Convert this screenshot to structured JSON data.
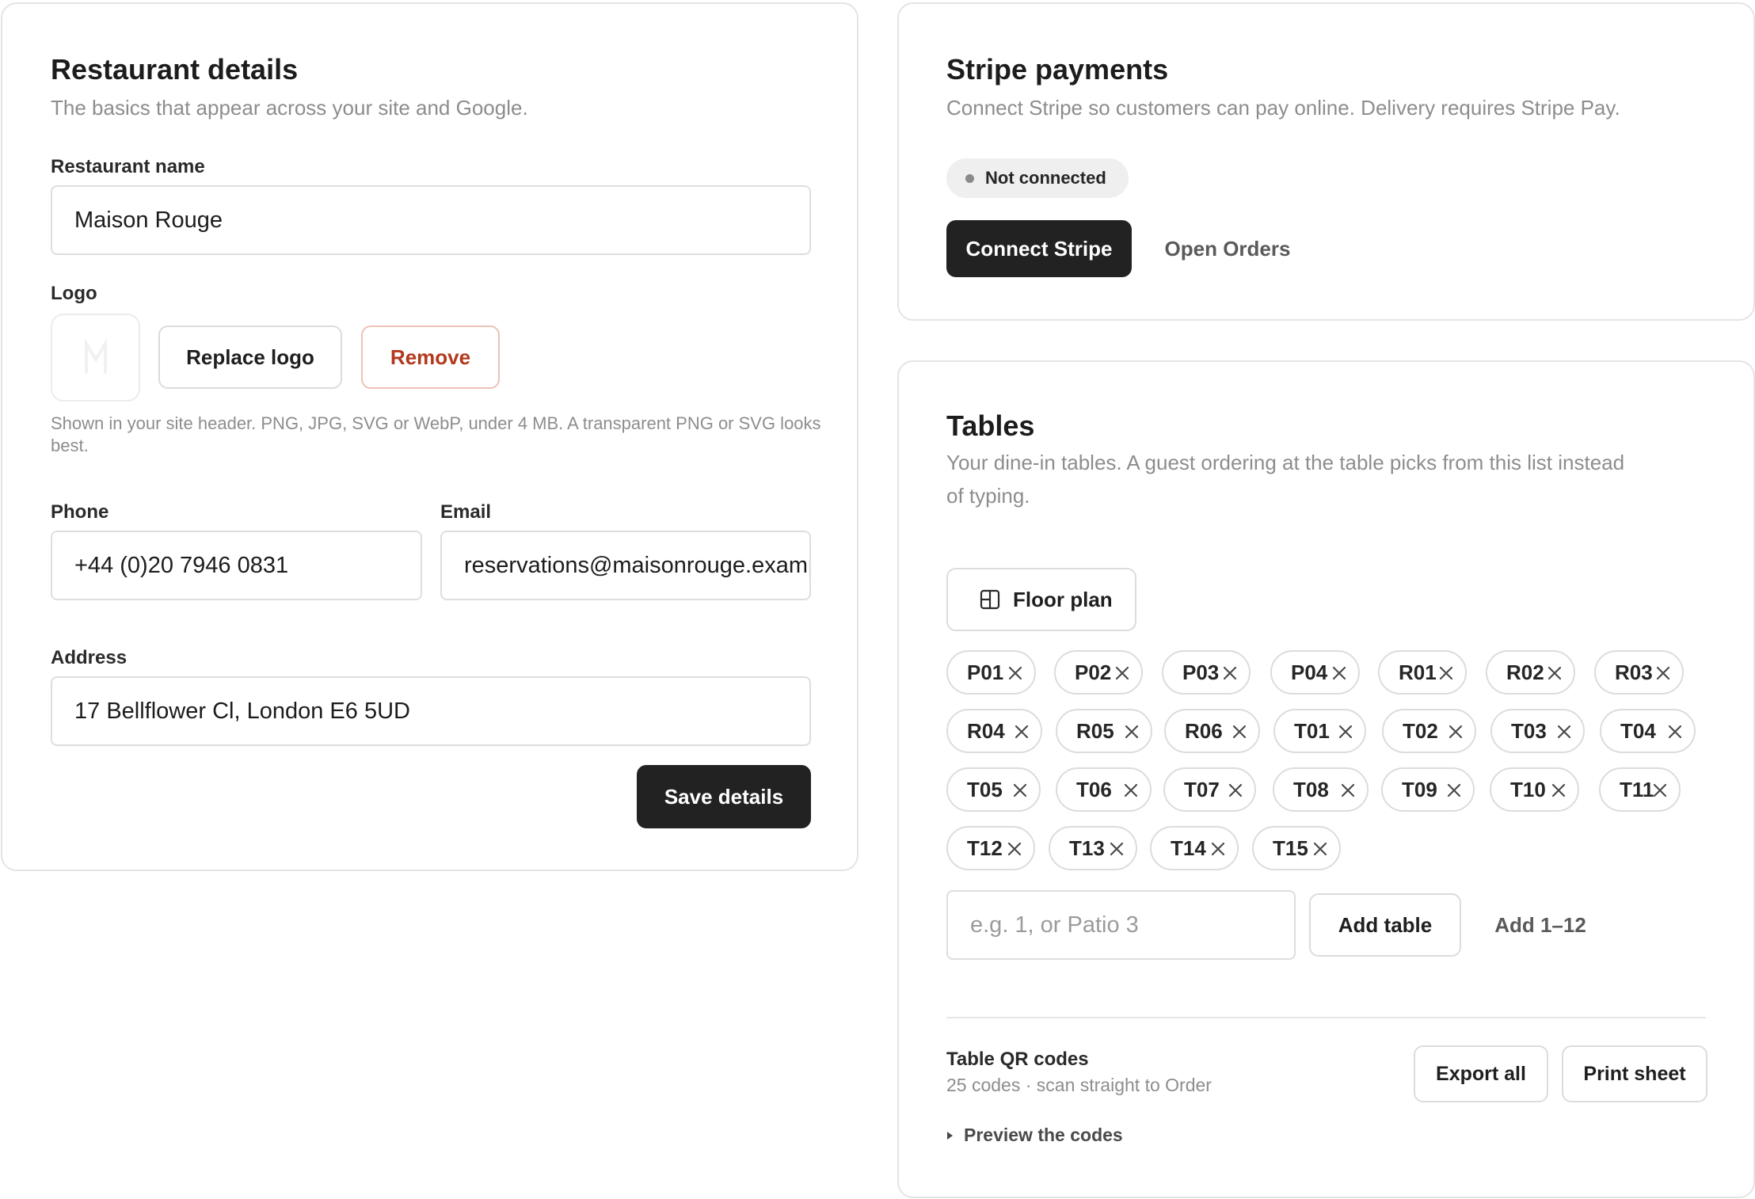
{
  "details": {
    "title": "Restaurant details",
    "subtitle": "The basics that appear across your site and Google.",
    "name_label": "Restaurant name",
    "name_value": "Maison Rouge",
    "logo_label": "Logo",
    "replace_logo": "Replace logo",
    "remove": "Remove",
    "logo_help": "Shown in your site header. PNG, JPG, SVG or WebP, under 4 MB. A transparent PNG or SVG looks best.",
    "phone_label": "Phone",
    "phone_value": "+44 (0)20 7946 0831",
    "email_label": "Email",
    "email_value": "reservations@maisonrouge.example",
    "address_label": "Address",
    "address_value": "17 Bellflower Cl, London E6 5UD",
    "save": "Save details"
  },
  "stripe": {
    "title": "Stripe payments",
    "subtitle": "Connect Stripe so customers can pay online. Delivery requires Stripe Pay.",
    "status": "Not connected",
    "connect": "Connect Stripe",
    "open_orders": "Open Orders"
  },
  "tables": {
    "title": "Tables",
    "subtitle_line1": "Your dine-in tables. A guest ordering at the table picks from this list instead",
    "subtitle_line2": "of typing.",
    "floor_plan": "Floor plan",
    "chips": [
      "P01",
      "P02",
      "P03",
      "P04",
      "R01",
      "R02",
      "R03",
      "R04",
      "R05",
      "R06",
      "T01",
      "T02",
      "T03",
      "T04",
      "T05",
      "T06",
      "T07",
      "T08",
      "T09",
      "T10",
      "T11",
      "T12",
      "T13",
      "T14",
      "T15"
    ],
    "input_placeholder": "e.g. 1, or Patio 3",
    "add_table": "Add table",
    "add_range": "Add 1–12",
    "qr_title": "Table QR codes",
    "qr_sub": "25 codes · scan straight to Order",
    "export_all": "Export all",
    "print_sheet": "Print sheet",
    "preview": "Preview the codes"
  },
  "colors": {
    "dark_button": "#222222",
    "danger": "#b3391d",
    "border": "#dcdcdc",
    "muted_text": "#8d8d8d"
  }
}
